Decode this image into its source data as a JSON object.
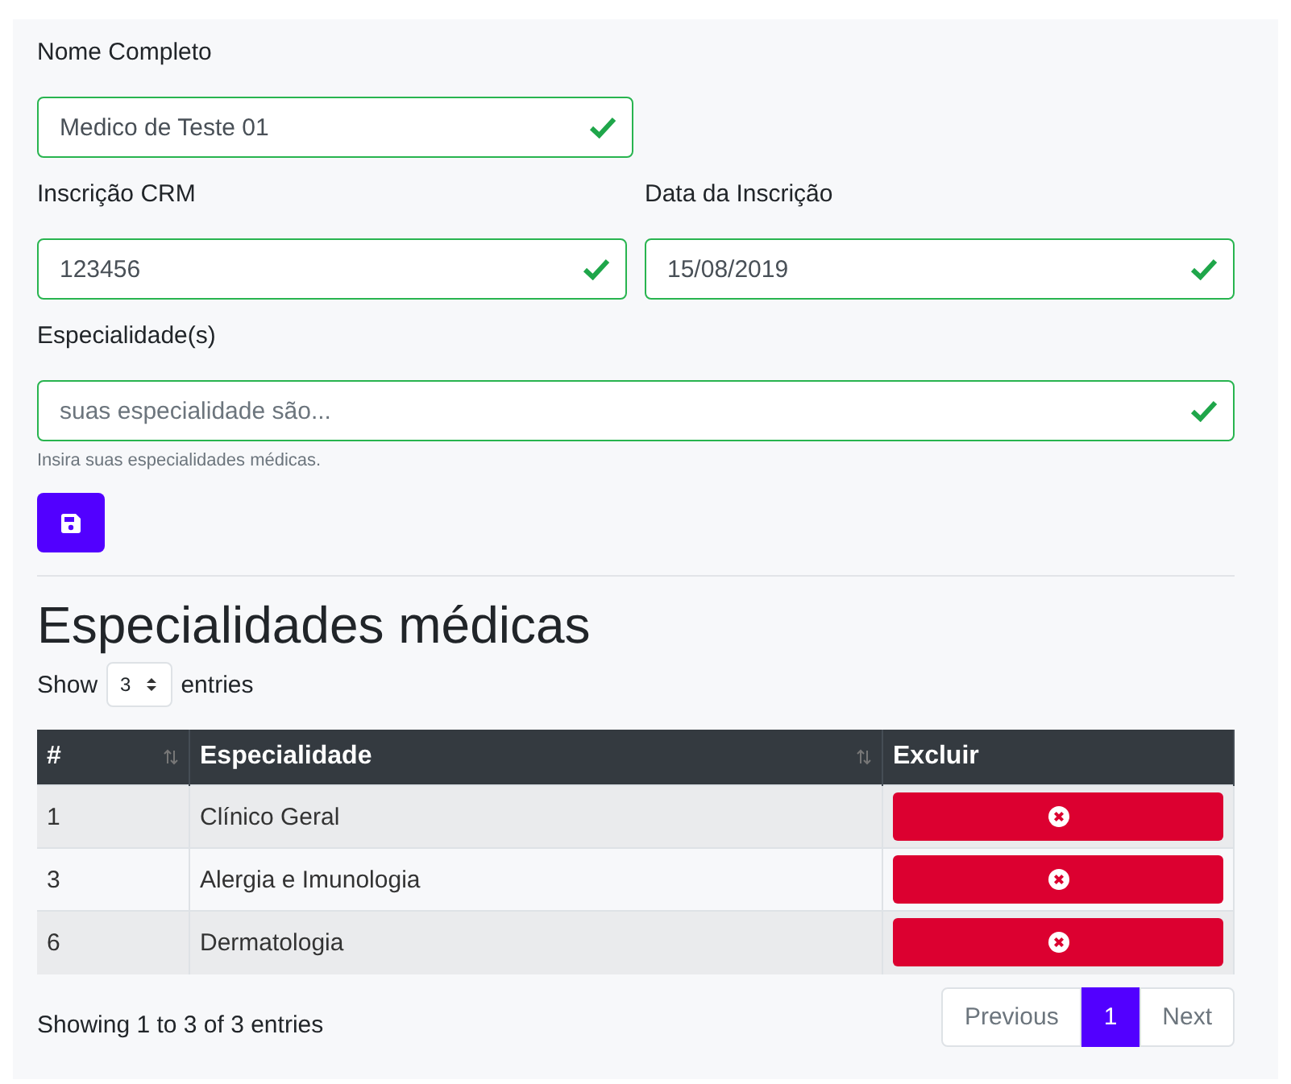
{
  "form": {
    "rows": [
      [
        {
          "label": "Nome Completo",
          "value": "Medico de Teste 01",
          "valid": true
        }
      ],
      [
        {
          "label": "Inscrição CRM",
          "value": "123456",
          "valid": true
        },
        {
          "label": "Data da Inscrição",
          "value": "15/08/2019",
          "valid": true
        }
      ],
      [
        {
          "label": "Especialidade(s)",
          "placeholder": "suas especialidade são...",
          "valid": true,
          "help": "Insira suas especialidades médicas."
        }
      ]
    ]
  },
  "heading": "Especialidades médicas",
  "length_menu": {
    "before": "Show",
    "value": "3",
    "after": "entries"
  },
  "table": {
    "columns": [
      {
        "label": "#",
        "sortable": true
      },
      {
        "label": "Especialidade",
        "sortable": true
      },
      {
        "label": "Excluir",
        "sortable": false
      }
    ],
    "rows": [
      {
        "id": "1",
        "name": "Clínico Geral"
      },
      {
        "id": "3",
        "name": "Alergia e Imunologia"
      },
      {
        "id": "6",
        "name": "Dermatologia"
      }
    ]
  },
  "info": "Showing 1 to 3 of 3 entries",
  "pagination": [
    {
      "label": "Previous",
      "selected": false
    },
    {
      "label": "1",
      "selected": true
    },
    {
      "label": "Next",
      "selected": false
    }
  ]
}
